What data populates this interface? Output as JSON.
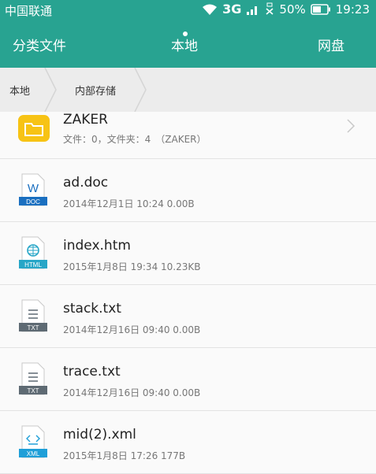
{
  "status_bar": {
    "carrier": "中国联通",
    "network": "3G",
    "battery": "50%",
    "time": "19:23"
  },
  "tabs": [
    {
      "label": "分类文件"
    },
    {
      "label": "本地"
    },
    {
      "label": "网盘"
    }
  ],
  "breadcrumb": [
    {
      "label": "本地"
    },
    {
      "label": "内部存储"
    }
  ],
  "files": [
    {
      "name": "ZAKER",
      "meta": "文件：0，文件夹：4　（ZAKER）",
      "icon": "folder-icon"
    },
    {
      "name": "ad.doc",
      "meta": "2014年12月1日 10:24 0.00B",
      "icon": "doc-file-icon",
      "badge": "DOC",
      "glyph": "W",
      "color": "#1a6fc0"
    },
    {
      "name": "index.htm",
      "meta": "2015年1月8日 19:34 10.23KB",
      "icon": "html-file-icon",
      "badge": "HTML",
      "color": "#27a6c7"
    },
    {
      "name": "stack.txt",
      "meta": "2014年12月16日 09:40 0.00B",
      "icon": "txt-file-icon",
      "badge": "TXT",
      "color": "#5e6a73"
    },
    {
      "name": "trace.txt",
      "meta": "2014年12月16日 09:40 0.00B",
      "icon": "txt-file-icon",
      "badge": "TXT",
      "color": "#5e6a73"
    },
    {
      "name": "mid(2).xml",
      "meta": "2015年1月8日 17:26 177B",
      "icon": "xml-file-icon",
      "badge": "XML",
      "color": "#1e9fd8"
    }
  ]
}
